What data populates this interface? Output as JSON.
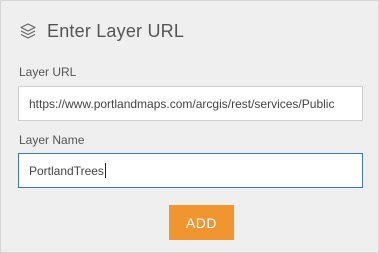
{
  "header": {
    "icon": "layers-icon",
    "title": "Enter Layer URL"
  },
  "form": {
    "layer_url": {
      "label": "Layer URL",
      "value": "https://www.portlandmaps.com/arcgis/rest/services/Public"
    },
    "layer_name": {
      "label": "Layer Name",
      "value": "PortlandTrees"
    },
    "add_button": {
      "label": "ADD",
      "color": "#f0952f"
    }
  }
}
